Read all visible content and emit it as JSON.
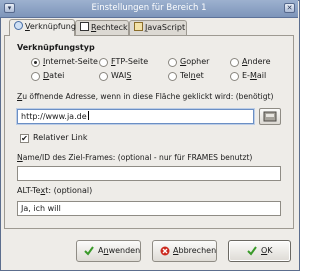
{
  "window": {
    "title": "Einstellungen für Bereich 1",
    "menu_icon": "window-menu-icon",
    "close_icon": "close-icon"
  },
  "tabs": [
    {
      "label": "Verknüpfung",
      "accel": "V",
      "rest": "erknüpfung",
      "icon": "link-icon",
      "active": true
    },
    {
      "label": "Rechteck",
      "accel": "R",
      "rest": "echteck",
      "icon": "rectangle-icon",
      "active": false
    },
    {
      "label": "JavaScript",
      "accel": "J",
      "rest": "avaScript",
      "icon": "javascript-icon",
      "active": false
    }
  ],
  "link_type": {
    "heading": "Verknüpfungstyp",
    "options": [
      {
        "label": "Internet-Seite",
        "accel": "I",
        "rest": "nternet-Seite",
        "selected": true
      },
      {
        "label": "FTP-Seite",
        "accel": "F",
        "rest": "TP-Seite",
        "selected": false
      },
      {
        "label": "Gopher",
        "accel": "G",
        "rest": "opher",
        "selected": false
      },
      {
        "label": "Andere",
        "accel": "A",
        "rest": "ndere",
        "selected": false
      },
      {
        "label": "Datei",
        "accel": "D",
        "rest": "atei",
        "selected": false
      },
      {
        "label": "WAIS",
        "pre": "WAI",
        "accel": "S",
        "selected": false
      },
      {
        "label": "Telnet",
        "pre": "Tel",
        "accel": "n",
        "rest": "et",
        "selected": false
      },
      {
        "label": "E-Mail",
        "pre": "E-",
        "accel": "M",
        "rest": "ail",
        "selected": false
      }
    ]
  },
  "url": {
    "label": "Zu öffnende Adresse, wenn in diese Fläche geklickt wird: (benötigt)",
    "label_accel": "Z",
    "label_rest": "u öffnende Adresse, wenn in diese Fläche geklickt wird: (benötigt)",
    "value": "http://www.ja.de",
    "browse_icon": "folder-browse-icon"
  },
  "relative_link": {
    "label": "Relativer Link",
    "checked": true,
    "check_mark": "✔"
  },
  "target_frame": {
    "label": "Name/ID des Ziel-Frames: (optional - nur für FRAMES benutzt)",
    "label_accel": "N",
    "label_rest": "ame/ID des Ziel-Frames: (optional - nur für FRAMES benutzt)",
    "value": ""
  },
  "alt_text": {
    "label": "ALT-Text: (optional)",
    "label_pre": "ALT-Te",
    "label_accel": "x",
    "label_rest": "t: (optional)",
    "value": "Ja, ich will"
  },
  "buttons": {
    "apply": {
      "label": "Anwenden",
      "pre": "A",
      "accel": "n",
      "rest": "wenden",
      "icon": "apply-check-icon",
      "color": "#3a9a2a"
    },
    "cancel": {
      "label": "Abbrechen",
      "accel": "A",
      "rest": "bbrechen",
      "icon": "cancel-icon",
      "color": "#cc2a1f"
    },
    "ok": {
      "label": "OK",
      "accel": "O",
      "rest": "K",
      "icon": "ok-check-icon",
      "color": "#3a9a2a"
    }
  }
}
